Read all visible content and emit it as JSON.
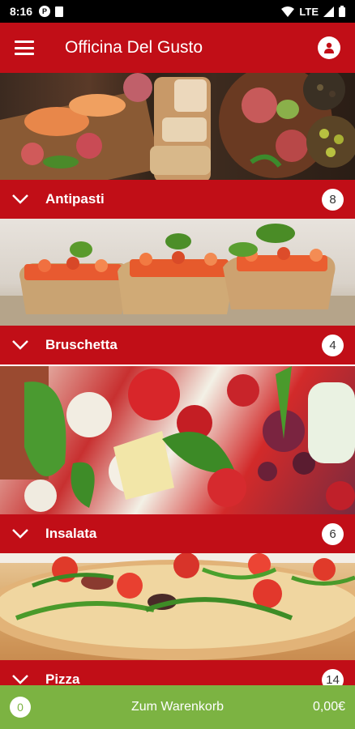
{
  "status_bar": {
    "time": "8:16",
    "network": "LTE"
  },
  "app_bar": {
    "title": "Officina Del Gusto",
    "menu_icon": "hamburger-menu-icon",
    "account_icon": "account-icon"
  },
  "categories": [
    {
      "name": "Antipasti",
      "count": "8"
    },
    {
      "name": "Bruschetta",
      "count": "4"
    },
    {
      "name": "Insalata",
      "count": "6"
    },
    {
      "name": "Pizza",
      "count": "14"
    }
  ],
  "cart": {
    "count": "0",
    "label": "Zum Warenkorb",
    "total": "0,00€"
  },
  "colors": {
    "primary": "#c10e17",
    "cart_bar": "#7cb342"
  }
}
